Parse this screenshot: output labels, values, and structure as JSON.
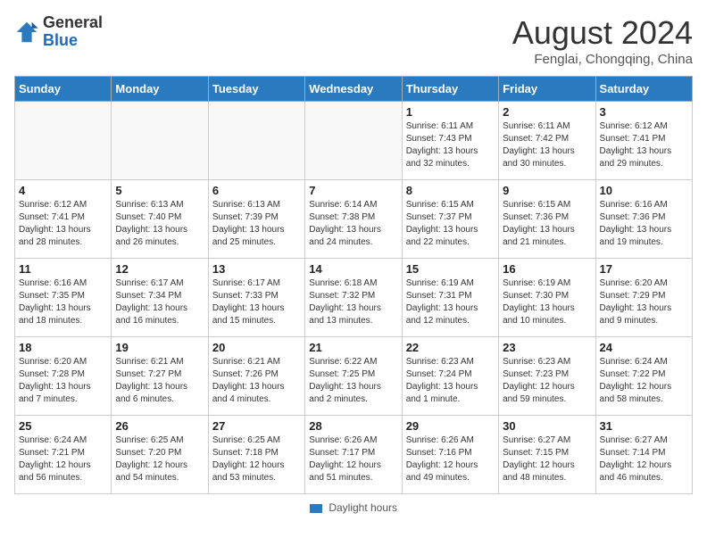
{
  "header": {
    "logo_general": "General",
    "logo_blue": "Blue",
    "month_year": "August 2024",
    "location": "Fenglai, Chongqing, China"
  },
  "weekdays": [
    "Sunday",
    "Monday",
    "Tuesday",
    "Wednesday",
    "Thursday",
    "Friday",
    "Saturday"
  ],
  "footer": {
    "label": "Daylight hours"
  },
  "weeks": [
    [
      {
        "day": "",
        "sunrise": "",
        "sunset": "",
        "daylight": ""
      },
      {
        "day": "",
        "sunrise": "",
        "sunset": "",
        "daylight": ""
      },
      {
        "day": "",
        "sunrise": "",
        "sunset": "",
        "daylight": ""
      },
      {
        "day": "",
        "sunrise": "",
        "sunset": "",
        "daylight": ""
      },
      {
        "day": "1",
        "sunrise": "Sunrise: 6:11 AM",
        "sunset": "Sunset: 7:43 PM",
        "daylight": "Daylight: 13 hours and 32 minutes."
      },
      {
        "day": "2",
        "sunrise": "Sunrise: 6:11 AM",
        "sunset": "Sunset: 7:42 PM",
        "daylight": "Daylight: 13 hours and 30 minutes."
      },
      {
        "day": "3",
        "sunrise": "Sunrise: 6:12 AM",
        "sunset": "Sunset: 7:41 PM",
        "daylight": "Daylight: 13 hours and 29 minutes."
      }
    ],
    [
      {
        "day": "4",
        "sunrise": "Sunrise: 6:12 AM",
        "sunset": "Sunset: 7:41 PM",
        "daylight": "Daylight: 13 hours and 28 minutes."
      },
      {
        "day": "5",
        "sunrise": "Sunrise: 6:13 AM",
        "sunset": "Sunset: 7:40 PM",
        "daylight": "Daylight: 13 hours and 26 minutes."
      },
      {
        "day": "6",
        "sunrise": "Sunrise: 6:13 AM",
        "sunset": "Sunset: 7:39 PM",
        "daylight": "Daylight: 13 hours and 25 minutes."
      },
      {
        "day": "7",
        "sunrise": "Sunrise: 6:14 AM",
        "sunset": "Sunset: 7:38 PM",
        "daylight": "Daylight: 13 hours and 24 minutes."
      },
      {
        "day": "8",
        "sunrise": "Sunrise: 6:15 AM",
        "sunset": "Sunset: 7:37 PM",
        "daylight": "Daylight: 13 hours and 22 minutes."
      },
      {
        "day": "9",
        "sunrise": "Sunrise: 6:15 AM",
        "sunset": "Sunset: 7:36 PM",
        "daylight": "Daylight: 13 hours and 21 minutes."
      },
      {
        "day": "10",
        "sunrise": "Sunrise: 6:16 AM",
        "sunset": "Sunset: 7:36 PM",
        "daylight": "Daylight: 13 hours and 19 minutes."
      }
    ],
    [
      {
        "day": "11",
        "sunrise": "Sunrise: 6:16 AM",
        "sunset": "Sunset: 7:35 PM",
        "daylight": "Daylight: 13 hours and 18 minutes."
      },
      {
        "day": "12",
        "sunrise": "Sunrise: 6:17 AM",
        "sunset": "Sunset: 7:34 PM",
        "daylight": "Daylight: 13 hours and 16 minutes."
      },
      {
        "day": "13",
        "sunrise": "Sunrise: 6:17 AM",
        "sunset": "Sunset: 7:33 PM",
        "daylight": "Daylight: 13 hours and 15 minutes."
      },
      {
        "day": "14",
        "sunrise": "Sunrise: 6:18 AM",
        "sunset": "Sunset: 7:32 PM",
        "daylight": "Daylight: 13 hours and 13 minutes."
      },
      {
        "day": "15",
        "sunrise": "Sunrise: 6:19 AM",
        "sunset": "Sunset: 7:31 PM",
        "daylight": "Daylight: 13 hours and 12 minutes."
      },
      {
        "day": "16",
        "sunrise": "Sunrise: 6:19 AM",
        "sunset": "Sunset: 7:30 PM",
        "daylight": "Daylight: 13 hours and 10 minutes."
      },
      {
        "day": "17",
        "sunrise": "Sunrise: 6:20 AM",
        "sunset": "Sunset: 7:29 PM",
        "daylight": "Daylight: 13 hours and 9 minutes."
      }
    ],
    [
      {
        "day": "18",
        "sunrise": "Sunrise: 6:20 AM",
        "sunset": "Sunset: 7:28 PM",
        "daylight": "Daylight: 13 hours and 7 minutes."
      },
      {
        "day": "19",
        "sunrise": "Sunrise: 6:21 AM",
        "sunset": "Sunset: 7:27 PM",
        "daylight": "Daylight: 13 hours and 6 minutes."
      },
      {
        "day": "20",
        "sunrise": "Sunrise: 6:21 AM",
        "sunset": "Sunset: 7:26 PM",
        "daylight": "Daylight: 13 hours and 4 minutes."
      },
      {
        "day": "21",
        "sunrise": "Sunrise: 6:22 AM",
        "sunset": "Sunset: 7:25 PM",
        "daylight": "Daylight: 13 hours and 2 minutes."
      },
      {
        "day": "22",
        "sunrise": "Sunrise: 6:23 AM",
        "sunset": "Sunset: 7:24 PM",
        "daylight": "Daylight: 13 hours and 1 minute."
      },
      {
        "day": "23",
        "sunrise": "Sunrise: 6:23 AM",
        "sunset": "Sunset: 7:23 PM",
        "daylight": "Daylight: 12 hours and 59 minutes."
      },
      {
        "day": "24",
        "sunrise": "Sunrise: 6:24 AM",
        "sunset": "Sunset: 7:22 PM",
        "daylight": "Daylight: 12 hours and 58 minutes."
      }
    ],
    [
      {
        "day": "25",
        "sunrise": "Sunrise: 6:24 AM",
        "sunset": "Sunset: 7:21 PM",
        "daylight": "Daylight: 12 hours and 56 minutes."
      },
      {
        "day": "26",
        "sunrise": "Sunrise: 6:25 AM",
        "sunset": "Sunset: 7:20 PM",
        "daylight": "Daylight: 12 hours and 54 minutes."
      },
      {
        "day": "27",
        "sunrise": "Sunrise: 6:25 AM",
        "sunset": "Sunset: 7:18 PM",
        "daylight": "Daylight: 12 hours and 53 minutes."
      },
      {
        "day": "28",
        "sunrise": "Sunrise: 6:26 AM",
        "sunset": "Sunset: 7:17 PM",
        "daylight": "Daylight: 12 hours and 51 minutes."
      },
      {
        "day": "29",
        "sunrise": "Sunrise: 6:26 AM",
        "sunset": "Sunset: 7:16 PM",
        "daylight": "Daylight: 12 hours and 49 minutes."
      },
      {
        "day": "30",
        "sunrise": "Sunrise: 6:27 AM",
        "sunset": "Sunset: 7:15 PM",
        "daylight": "Daylight: 12 hours and 48 minutes."
      },
      {
        "day": "31",
        "sunrise": "Sunrise: 6:27 AM",
        "sunset": "Sunset: 7:14 PM",
        "daylight": "Daylight: 12 hours and 46 minutes."
      }
    ]
  ]
}
